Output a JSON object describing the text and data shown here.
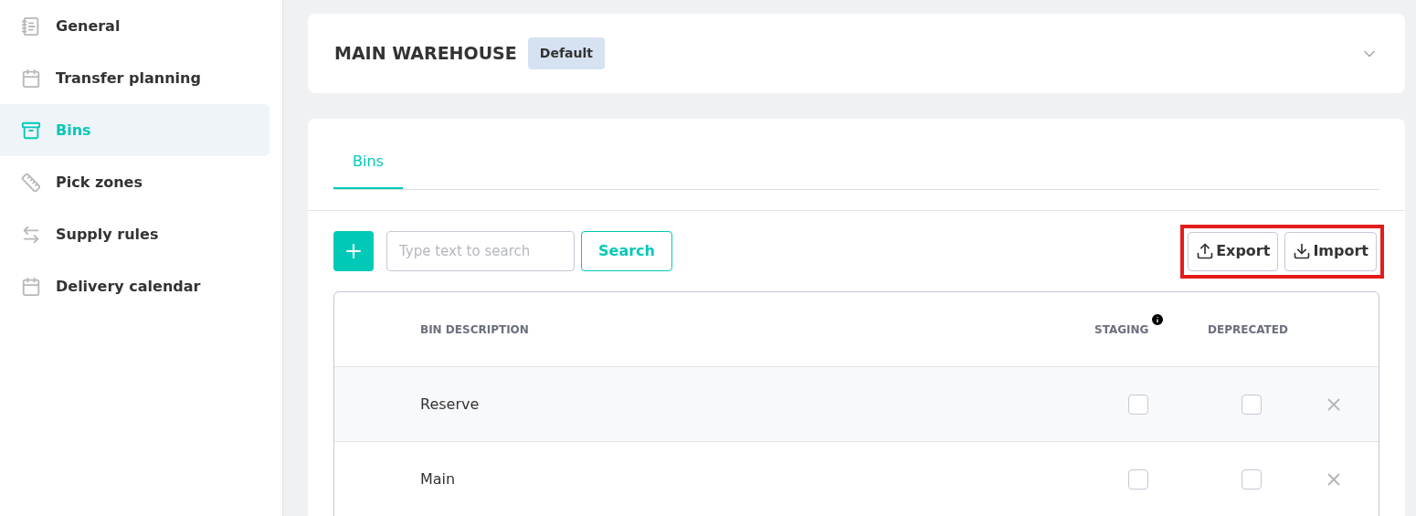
{
  "sidebar": {
    "items": [
      {
        "label": "General",
        "kind": "notes",
        "selected": false
      },
      {
        "label": "Transfer planning",
        "kind": "calendar",
        "selected": false
      },
      {
        "label": "Bins",
        "kind": "box",
        "selected": true
      },
      {
        "label": "Pick zones",
        "kind": "ruler",
        "selected": false
      },
      {
        "label": "Supply rules",
        "kind": "arrows",
        "selected": false
      },
      {
        "label": "Delivery calendar",
        "kind": "calendar",
        "selected": false
      }
    ]
  },
  "warehouse": {
    "title": "MAIN WAREHOUSE",
    "badge": "Default",
    "expanded": false
  },
  "tabs": [
    {
      "label": "Bins",
      "selected": true
    }
  ],
  "toolbar": {
    "search": {
      "placeholder": "Type text to search"
    },
    "search_button": "Search",
    "export": "Export",
    "import": "Import",
    "highlighted": true
  },
  "table": {
    "columns": [
      "BIN DESCRIPTION",
      "STAGING",
      "DEPRECATED"
    ],
    "rows": [
      {
        "description": "Reserve",
        "staging": false,
        "deprecated": false
      },
      {
        "description": "Main",
        "staging": false,
        "deprecated": false
      }
    ]
  }
}
